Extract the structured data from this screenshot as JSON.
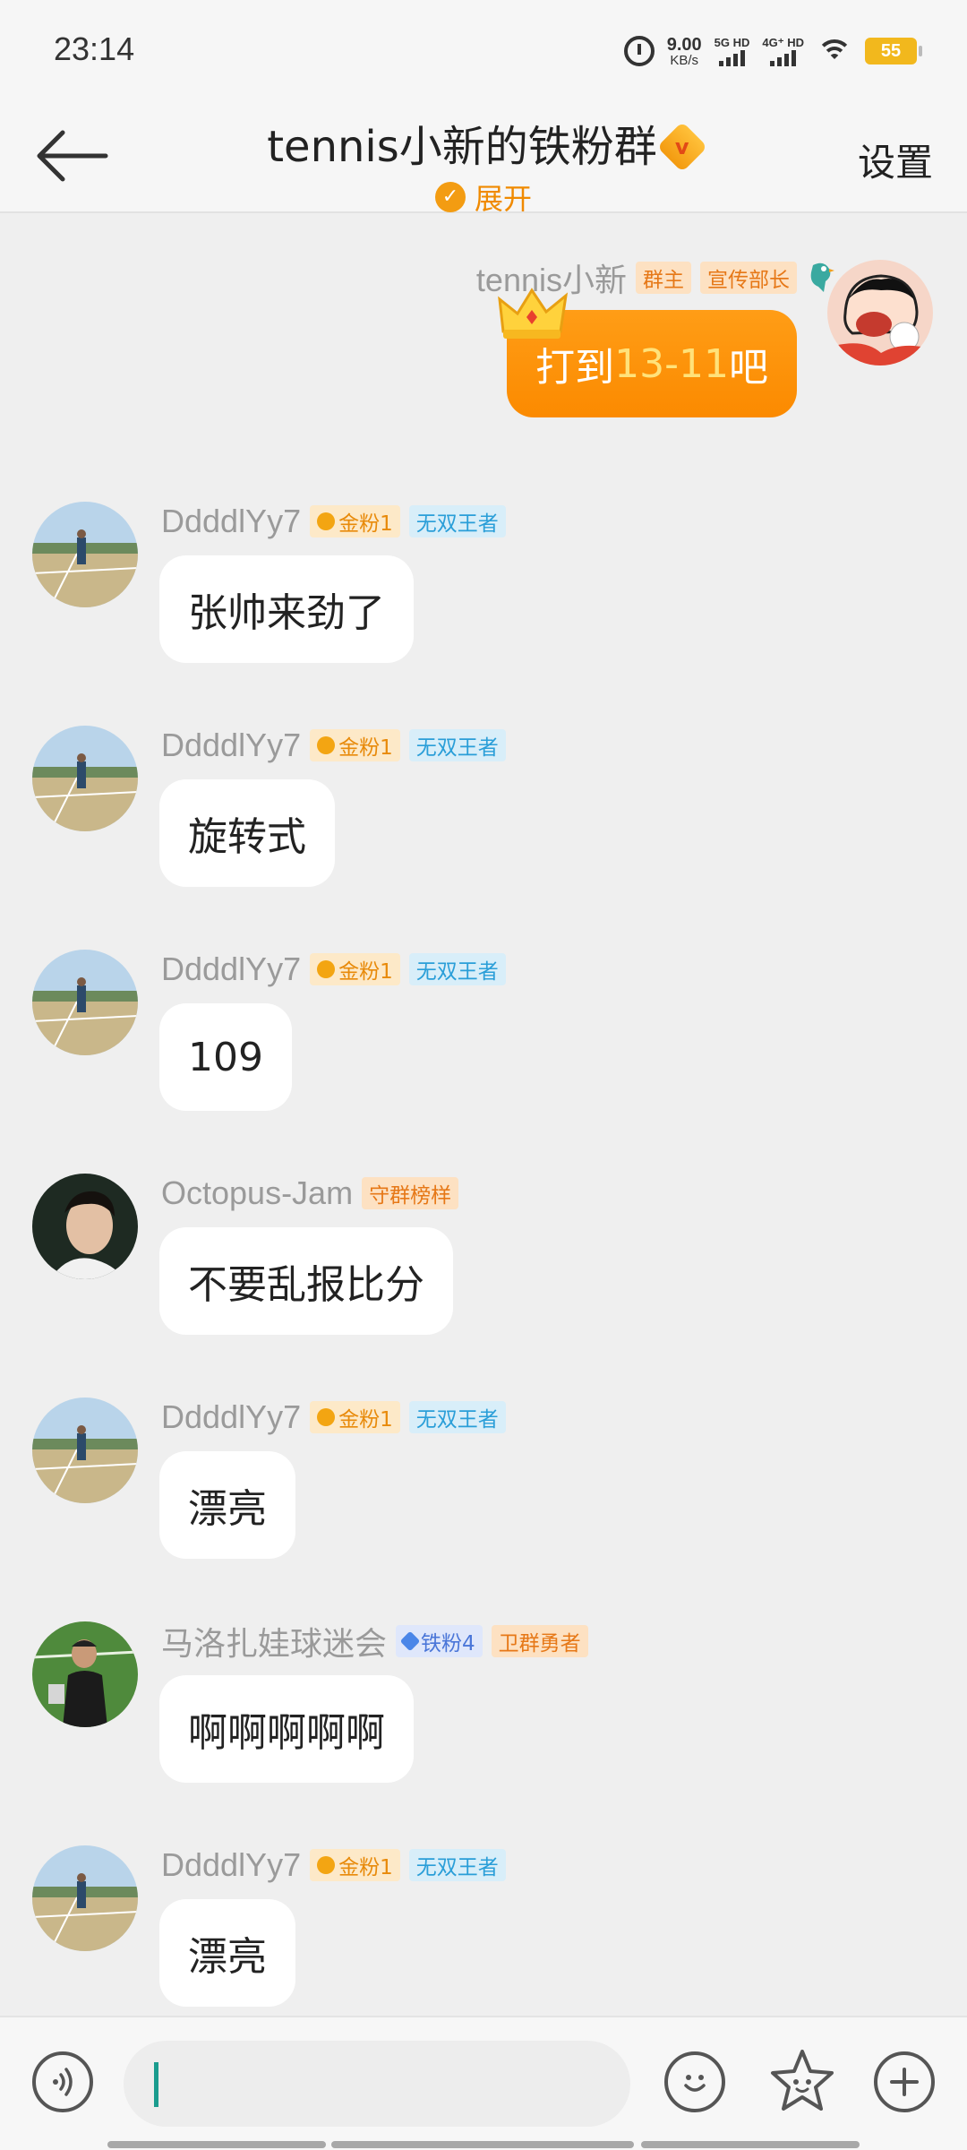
{
  "status_bar": {
    "time": "23:14",
    "net_speed": "9.00",
    "net_unit": "KB/s",
    "sim1_label": "5G HD",
    "sim2_label": "4G⁺ HD",
    "battery": "55"
  },
  "header": {
    "title": "tennis小新的铁粉群",
    "vip_icon": "v",
    "expand_label": "展开",
    "settings_label": "设置"
  },
  "messages": [
    {
      "user": "tennis小新",
      "tags": [
        "群主",
        "宣传部长"
      ],
      "text_prefix": "打到",
      "text_score": "13-11",
      "text_suffix": "吧",
      "own": true
    },
    {
      "user": "DdddlYy7",
      "tags": [
        "金粉1",
        "无双王者"
      ],
      "text": "张帅来劲了"
    },
    {
      "user": "DdddlYy7",
      "tags": [
        "金粉1",
        "无双王者"
      ],
      "text": "旋转式"
    },
    {
      "user": "DdddlYy7",
      "tags": [
        "金粉1",
        "无双王者"
      ],
      "text": "109"
    },
    {
      "user": "Octopus-Jam",
      "tags": [
        "守群榜样"
      ],
      "text": "不要乱报比分"
    },
    {
      "user": "DdddlYy7",
      "tags": [
        "金粉1",
        "无双王者"
      ],
      "text": "漂亮"
    },
    {
      "user": "马洛扎娃球迷会",
      "tags": [
        "铁粉4",
        "卫群勇者"
      ],
      "text": "啊啊啊啊啊"
    },
    {
      "user": "DdddlYy7",
      "tags": [
        "金粉1",
        "无双王者"
      ],
      "text": "漂亮"
    }
  ],
  "composer": {
    "placeholder": ""
  },
  "colors": {
    "accent": "#fb8a00",
    "gold_tag": "#e88a0a",
    "blue_tag": "#2a9ed8"
  }
}
